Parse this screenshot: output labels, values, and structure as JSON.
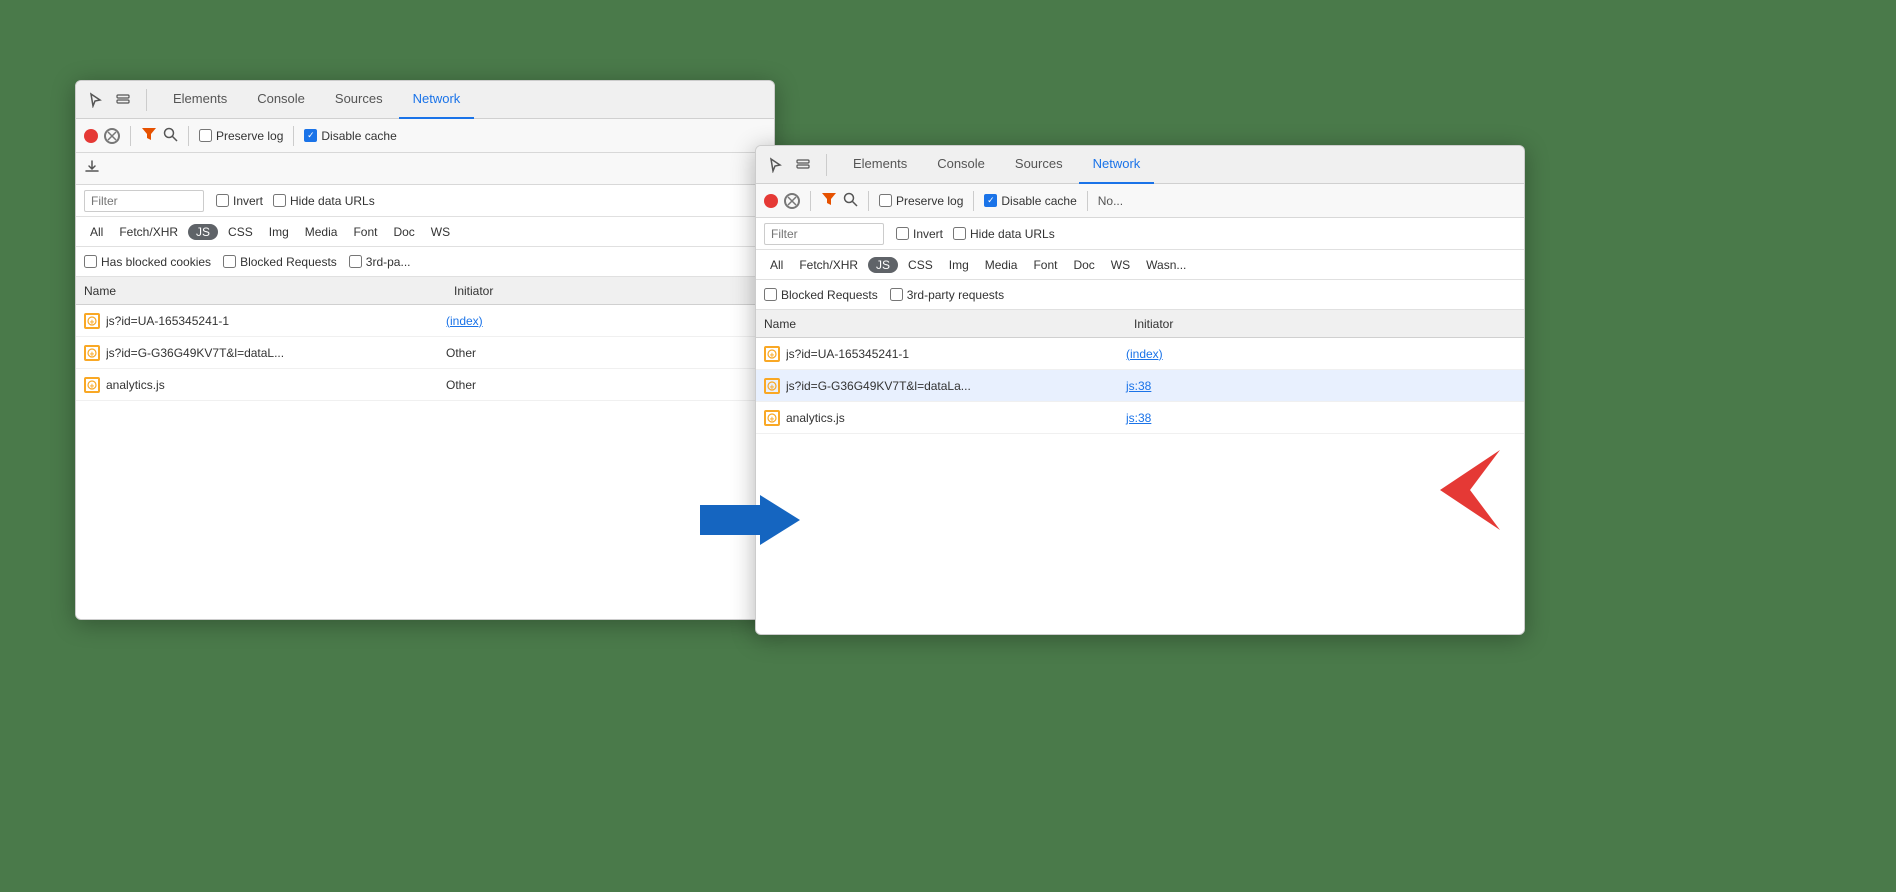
{
  "background_color": "#4a7a4a",
  "window1": {
    "tabs": {
      "icons": [
        "cursor-icon",
        "layers-icon"
      ],
      "items": [
        {
          "label": "Elements",
          "active": false
        },
        {
          "label": "Console",
          "active": false
        },
        {
          "label": "Sources",
          "active": false
        },
        {
          "label": "Network",
          "active": true
        }
      ]
    },
    "toolbar1": {
      "record_title": "Record",
      "clear_title": "Clear",
      "filter_title": "Filter",
      "search_title": "Search",
      "preserve_log_label": "Preserve log",
      "preserve_log_checked": false,
      "disable_cache_label": "Disable cache",
      "disable_cache_checked": true
    },
    "toolbar2": {
      "download_title": "Import/Export HAR"
    },
    "filter_bar": {
      "placeholder": "Filter",
      "invert_label": "Invert",
      "hide_data_urls_label": "Hide data URLs",
      "invert_checked": false,
      "hide_checked": false
    },
    "type_bar": {
      "items": [
        {
          "label": "All",
          "active": false
        },
        {
          "label": "Fetch/XHR",
          "active": false
        },
        {
          "label": "JS",
          "active": true
        },
        {
          "label": "CSS",
          "active": false
        },
        {
          "label": "Img",
          "active": false
        },
        {
          "label": "Media",
          "active": false
        },
        {
          "label": "Font",
          "active": false
        },
        {
          "label": "Doc",
          "active": false
        },
        {
          "label": "WS",
          "active": false
        }
      ]
    },
    "blocked_bar": {
      "has_blocked_cookies_label": "Has blocked cookies",
      "blocked_requests_label": "Blocked Requests",
      "third_party_label": "3rd-pa...",
      "has_blocked_checked": false,
      "blocked_checked": false,
      "third_checked": false
    },
    "table": {
      "col_name": "Name",
      "col_initiator": "Initiator",
      "rows": [
        {
          "icon": "⊕",
          "name": "js?id=UA-165345241-1",
          "initiator": "(index)",
          "initiator_link": true
        },
        {
          "icon": "⊕",
          "name": "js?id=G-G36G49KV7T&l=dataL...",
          "initiator": "Other",
          "initiator_link": false
        },
        {
          "icon": "⊕",
          "name": "analytics.js",
          "initiator": "Other",
          "initiator_link": false
        }
      ]
    }
  },
  "window2": {
    "tabs": {
      "items": [
        {
          "label": "Elements",
          "active": false
        },
        {
          "label": "Console",
          "active": false
        },
        {
          "label": "Sources",
          "active": false
        },
        {
          "label": "Network",
          "active": true
        }
      ]
    },
    "toolbar1": {
      "preserve_log_label": "Preserve log",
      "preserve_log_checked": false,
      "disable_cache_label": "Disable cache",
      "disable_cache_checked": true,
      "no_throttle_label": "No..."
    },
    "filter_bar": {
      "placeholder": "Filter",
      "invert_label": "Invert",
      "hide_data_urls_label": "Hide data URLs",
      "invert_checked": false,
      "hide_checked": false
    },
    "type_bar": {
      "items": [
        {
          "label": "All",
          "active": false
        },
        {
          "label": "Fetch/XHR",
          "active": false
        },
        {
          "label": "JS",
          "active": true
        },
        {
          "label": "CSS",
          "active": false
        },
        {
          "label": "Img",
          "active": false
        },
        {
          "label": "Media",
          "active": false
        },
        {
          "label": "Font",
          "active": false
        },
        {
          "label": "Doc",
          "active": false
        },
        {
          "label": "WS",
          "active": false
        },
        {
          "label": "Wasn...",
          "active": false
        }
      ]
    },
    "blocked_bar": {
      "blocked_requests_label": "Blocked Requests",
      "third_party_label": "3rd-party requests",
      "blocked_checked": false,
      "third_checked": false
    },
    "table": {
      "col_name": "Name",
      "col_initiator": "Initiator",
      "rows": [
        {
          "icon": "⊕",
          "name": "js?id=UA-165345241-1",
          "initiator": "(index)",
          "initiator_link": true
        },
        {
          "icon": "⊕",
          "name": "js?id=G-G36G49KV7T&l=dataLa...",
          "initiator": "js:38",
          "initiator_link": true,
          "highlighted": true
        },
        {
          "icon": "⊕",
          "name": "analytics.js",
          "initiator": "js:38",
          "initiator_link": true
        }
      ]
    }
  },
  "blue_arrow": {
    "label": "→"
  }
}
